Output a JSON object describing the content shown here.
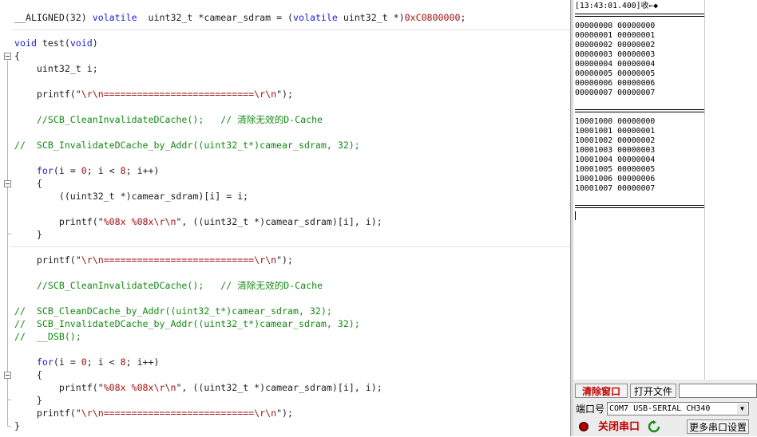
{
  "editor": {
    "lines": [
      {
        "segs": [
          {
            "t": "__ALIGNED(32) ",
            "c": ""
          },
          {
            "t": "volatile",
            "c": "kw"
          },
          {
            "t": "  uint32_t *camear_sdram = (",
            "c": ""
          },
          {
            "t": "volatile",
            "c": "kw"
          },
          {
            "t": " uint32_t *)",
            "c": ""
          },
          {
            "t": "0xC0800000",
            "c": "nm"
          },
          {
            "t": ";",
            "c": ""
          }
        ]
      },
      {
        "segs": [
          {
            "t": "void",
            "c": "kw"
          },
          {
            "t": " test(",
            "c": ""
          },
          {
            "t": "void",
            "c": "kw"
          },
          {
            "t": ")",
            "c": ""
          }
        ]
      },
      {
        "segs": [
          {
            "t": "{",
            "c": ""
          }
        ]
      },
      {
        "segs": [
          {
            "t": "    uint32_t i;",
            "c": ""
          }
        ]
      },
      {
        "segs": [
          {
            "t": "    printf(\"",
            "c": ""
          },
          {
            "t": "\\r\\n",
            "c": "esc"
          },
          {
            "t": "===========================",
            "c": "st"
          },
          {
            "t": "\\r\\n",
            "c": "esc"
          },
          {
            "t": "\");",
            "c": ""
          }
        ]
      },
      {
        "segs": [
          {
            "t": "    //SCB_CleanInvalidateDCache();   // 清除无效的D-Cache",
            "c": "cm"
          }
        ]
      },
      {
        "segs": [
          {
            "t": "//  SCB_InvalidateDCache_by_Addr((uint32_t*)camear_sdram, 32);",
            "c": "cm"
          }
        ]
      },
      {
        "segs": [
          {
            "t": "    ",
            "c": ""
          },
          {
            "t": "for",
            "c": "kw"
          },
          {
            "t": "(i = ",
            "c": ""
          },
          {
            "t": "0",
            "c": "nm"
          },
          {
            "t": "; i < ",
            "c": ""
          },
          {
            "t": "8",
            "c": "nm"
          },
          {
            "t": "; i++)",
            "c": ""
          }
        ]
      },
      {
        "segs": [
          {
            "t": "    {",
            "c": ""
          }
        ]
      },
      {
        "segs": [
          {
            "t": "        ((uint32_t *)camear_sdram)[i] = i;",
            "c": ""
          }
        ]
      },
      {
        "segs": [
          {
            "t": "        printf(\"",
            "c": ""
          },
          {
            "t": "%08x %08x\\r\\n",
            "c": "st"
          },
          {
            "t": "\", ((uint32_t *)camear_sdram)[i], i);",
            "c": ""
          }
        ]
      },
      {
        "segs": [
          {
            "t": "    }",
            "c": ""
          }
        ]
      },
      {
        "segs": [
          {
            "t": "    printf(\"",
            "c": ""
          },
          {
            "t": "\\r\\n",
            "c": "esc"
          },
          {
            "t": "===========================",
            "c": "st"
          },
          {
            "t": "\\r\\n",
            "c": "esc"
          },
          {
            "t": "\");",
            "c": ""
          }
        ]
      },
      {
        "segs": [
          {
            "t": "    //SCB_CleanInvalidateDCache();   // 清除无效的D-Cache",
            "c": "cm"
          }
        ]
      },
      {
        "segs": [
          {
            "t": "//  SCB_CleanDCache_by_Addr((uint32_t*)camear_sdram, 32);",
            "c": "cm"
          }
        ]
      },
      {
        "segs": [
          {
            "t": "//  SCB_InvalidateDCache_by_Addr((uint32_t*)camear_sdram, 32);",
            "c": "cm"
          }
        ]
      },
      {
        "segs": [
          {
            "t": "//  __DSB();",
            "c": "cm"
          }
        ]
      },
      {
        "segs": [
          {
            "t": "    ",
            "c": ""
          },
          {
            "t": "for",
            "c": "kw"
          },
          {
            "t": "(i = ",
            "c": ""
          },
          {
            "t": "0",
            "c": "nm"
          },
          {
            "t": "; i < ",
            "c": ""
          },
          {
            "t": "8",
            "c": "nm"
          },
          {
            "t": "; i++)",
            "c": ""
          }
        ]
      },
      {
        "segs": [
          {
            "t": "    {",
            "c": ""
          }
        ]
      },
      {
        "segs": [
          {
            "t": "        printf(\"",
            "c": ""
          },
          {
            "t": "%08x %08x\\r\\n",
            "c": "st"
          },
          {
            "t": "\", ((uint32_t *)camear_sdram)[i], i);",
            "c": ""
          }
        ]
      },
      {
        "segs": [
          {
            "t": "    }",
            "c": ""
          }
        ]
      },
      {
        "segs": [
          {
            "t": "    printf(\"",
            "c": ""
          },
          {
            "t": "\\r\\n",
            "c": "esc"
          },
          {
            "t": "===========================",
            "c": "st"
          },
          {
            "t": "\\r\\n",
            "c": "esc"
          },
          {
            "t": "\");",
            "c": ""
          }
        ]
      },
      {
        "segs": [
          {
            "t": "}",
            "c": ""
          }
        ]
      }
    ]
  },
  "serial": {
    "timestamp": "[13:43:01.400]收←◆",
    "block1": [
      "00000000 00000000",
      "00000001 00000001",
      "00000002 00000002",
      "00000003 00000003",
      "00000004 00000004",
      "00000005 00000005",
      "00000006 00000006",
      "00000007 00000007"
    ],
    "block2": [
      "10001000 00000000",
      "10001001 00000001",
      "10001002 00000002",
      "10001003 00000003",
      "10001004 00000004",
      "10001005 00000005",
      "10001006 00000006",
      "10001007 00000007"
    ]
  },
  "controls": {
    "clear_window": "清除窗口",
    "open_file": "打开文件",
    "port_label": "端口号",
    "port_value": "COM7 USB-SERIAL CH340",
    "close_port": "关闭串口",
    "more_settings": "更多串口设置",
    "accent": "#c00000"
  }
}
